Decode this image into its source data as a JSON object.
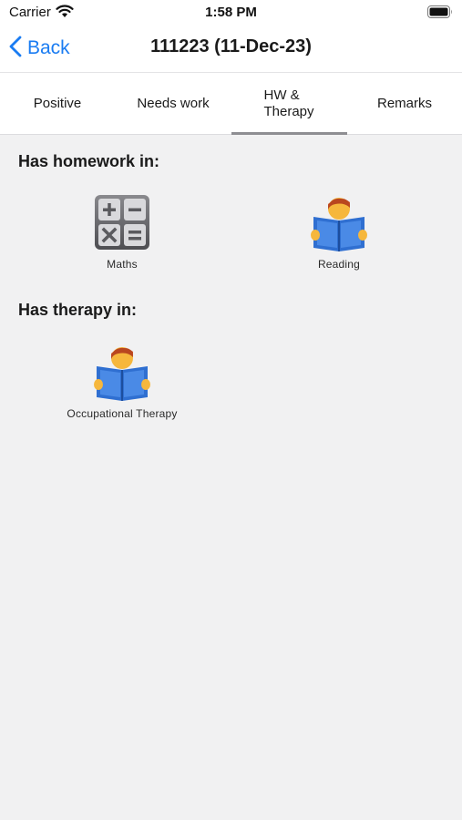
{
  "status_bar": {
    "carrier": "Carrier",
    "time": "1:58 PM"
  },
  "nav": {
    "back_label": "Back",
    "title": "111223 (11-Dec-23)",
    "accent_color": "#1a7cf2"
  },
  "tabs": [
    {
      "label": "Positive",
      "selected": false
    },
    {
      "label": "Needs work",
      "selected": false
    },
    {
      "label": "HW &\nTherapy",
      "selected": true
    },
    {
      "label": "Remarks",
      "selected": false
    }
  ],
  "homework": {
    "heading": "Has homework in:",
    "items": [
      {
        "label": "Maths",
        "icon": "calculator-icon"
      },
      {
        "label": "Reading",
        "icon": "person-reading-book-icon"
      }
    ]
  },
  "therapy": {
    "heading": "Has therapy in:",
    "items": [
      {
        "label": "Occupational Therapy",
        "icon": "person-reading-book-icon"
      }
    ]
  }
}
